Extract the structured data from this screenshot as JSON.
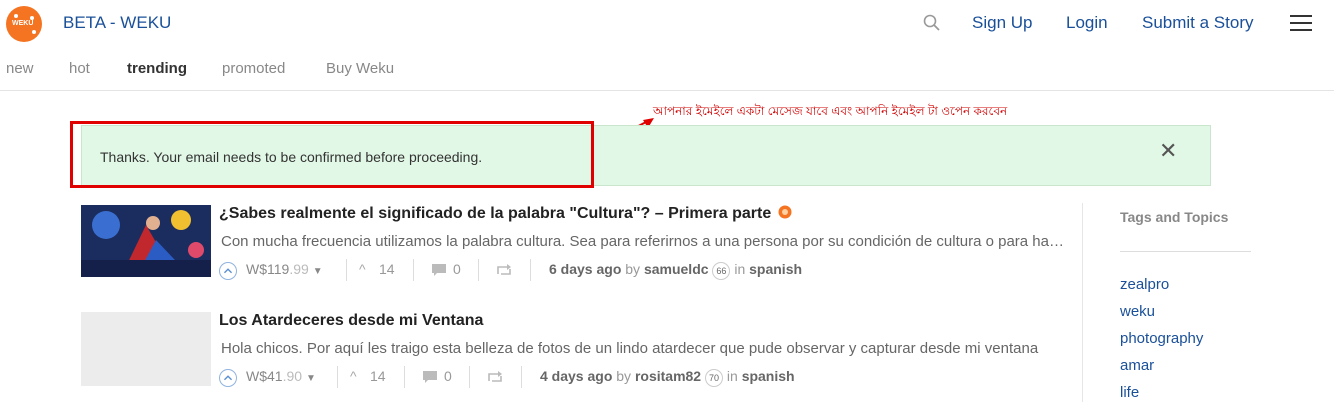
{
  "header": {
    "brand": "BETA - WEKU",
    "logo_text": "WEKU",
    "nav": [
      "Sign Up",
      "Login",
      "Submit a Story"
    ]
  },
  "subnav": [
    "new",
    "hot",
    "trending",
    "promoted",
    "Buy Weku"
  ],
  "annotation": "আপনার ইমেইলে একটা মেসেজ যাবে এবং আপনি ইমেইল টা ওপেন করবেন",
  "callout": {
    "message": "Thanks. Your email needs to be confirmed before proceeding.",
    "close": "✕"
  },
  "posts": [
    {
      "title": "¿Sabes realmente el significado de la palabra \"Cultura\"? – Primera parte",
      "excerpt": "Con mucha frecuencia utilizamos la palabra cultura. Sea para referirnos a una persona por su condición de cultura o para hablar de",
      "payout": "W$119",
      "payout_cents": ".99",
      "votes": "14",
      "comments": "0",
      "time": "6 days ago",
      "by": "by",
      "author": "samueldc",
      "reputation": "66",
      "in": "in",
      "category": "spanish"
    },
    {
      "title": "Los Atardeceres desde mi Ventana",
      "excerpt": "Hola chicos. Por aquí les traigo esta belleza de fotos de un lindo atardecer que pude observar y capturar desde mi ventana",
      "payout": "W$41",
      "payout_cents": ".90",
      "votes": "14",
      "comments": "0",
      "time": "4 days ago",
      "by": "by",
      "author": "rositam82",
      "reputation": "70",
      "in": "in",
      "category": "spanish"
    }
  ],
  "sidebar": {
    "title": "Tags and Topics",
    "tags": [
      "zealpro",
      "weku",
      "photography",
      "amar",
      "life"
    ]
  },
  "colors": {
    "brand_blue": "#1a5099",
    "logo_orange": "#f47421",
    "callout_bg": "#e2f8e6",
    "annotation_red": "#e00000"
  }
}
